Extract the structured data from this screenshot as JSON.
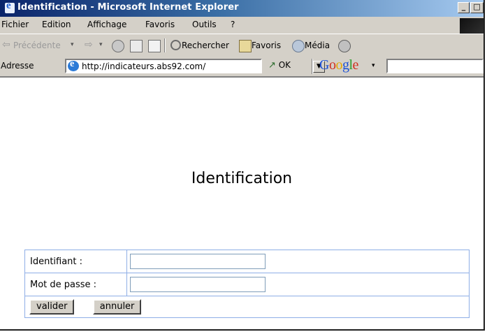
{
  "window": {
    "title": "Identification - Microsoft Internet Explorer",
    "controls": [
      "_",
      "□"
    ]
  },
  "menu": [
    "Fichier",
    "Edition",
    "Affichage",
    "Favoris",
    "Outils",
    "?"
  ],
  "toolbar": {
    "back": "Précédente",
    "search": "Rechercher",
    "favorites": "Favoris",
    "media": "Média"
  },
  "address": {
    "label": "Adresse",
    "url": "http://indicateurs.abs92.com/",
    "go": "OK",
    "google_letters": [
      "G",
      "o",
      "o",
      "g",
      "l",
      "e"
    ],
    "google_caret": "▾"
  },
  "page": {
    "heading": "Identification",
    "login_label": "Identifiant :",
    "login_value": "",
    "password_label": "Mot de passe :",
    "password_value": "",
    "submit_label": "valider",
    "cancel_label": "annuler"
  }
}
